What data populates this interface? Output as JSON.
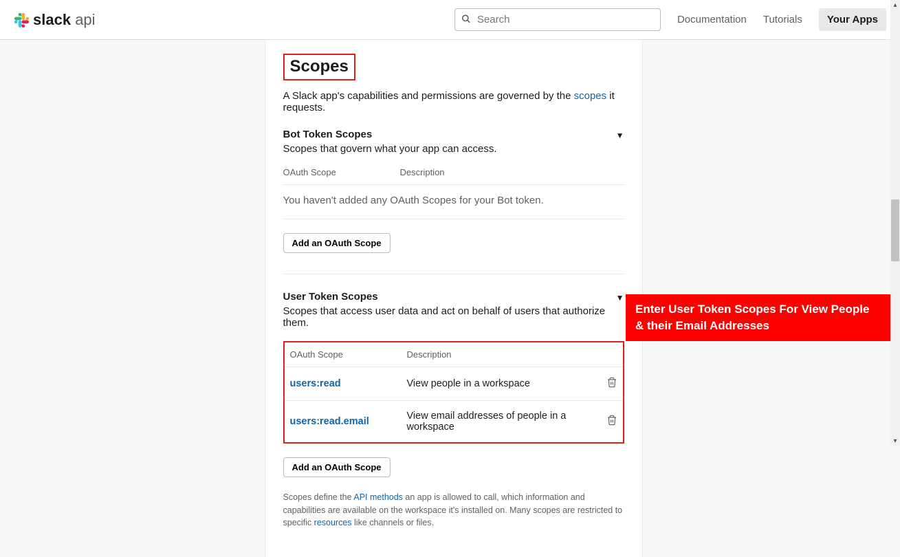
{
  "header": {
    "brand_main": "slack",
    "brand_sub": "api",
    "search_placeholder": "Search",
    "nav": {
      "docs": "Documentation",
      "tutorials": "Tutorials",
      "apps": "Your Apps"
    }
  },
  "main": {
    "title": "Scopes",
    "intro_prefix": "A Slack app's capabilities and permissions are governed by the ",
    "intro_link": "scopes",
    "intro_suffix": " it requests.",
    "bot": {
      "title": "Bot Token Scopes",
      "subtitle": "Scopes that govern what your app can access.",
      "col_scope": "OAuth Scope",
      "col_desc": "Description",
      "empty": "You haven't added any OAuth Scopes for your Bot token.",
      "add_btn": "Add an OAuth Scope"
    },
    "user": {
      "title": "User Token Scopes",
      "subtitle": "Scopes that access user data and act on behalf of users that authorize them.",
      "col_scope": "OAuth Scope",
      "col_desc": "Description",
      "rows": [
        {
          "scope": "users:read",
          "desc": "View people in a workspace"
        },
        {
          "scope": "users:read.email",
          "desc": "View email addresses of people in a workspace"
        }
      ],
      "add_btn": "Add an OAuth Scope"
    },
    "footer": {
      "t1": "Scopes define the ",
      "l1": "API methods",
      "t2": " an app is allowed to call, which information and capabilities are available on the workspace it's installed on. Many scopes are restricted to specific ",
      "l2": "resources",
      "t3": " like channels or files."
    }
  },
  "annotation": "Enter User Token Scopes For View People & their Email Addresses"
}
